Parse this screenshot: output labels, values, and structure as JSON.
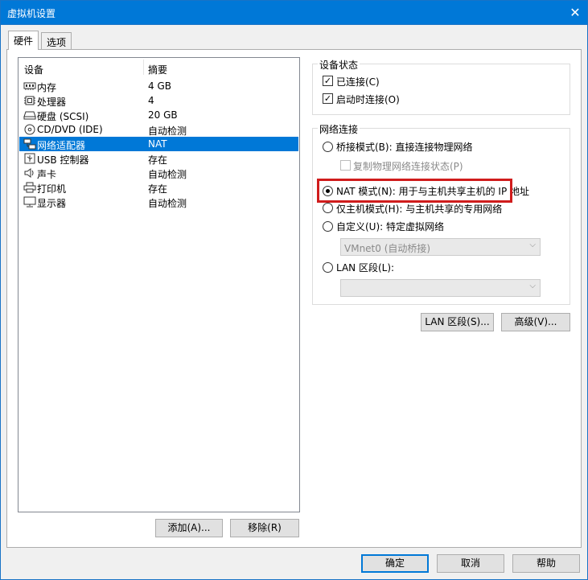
{
  "window": {
    "title": "虚拟机设置",
    "close": "✕"
  },
  "tabs": [
    {
      "label": "硬件"
    },
    {
      "label": "选项"
    }
  ],
  "device_list": {
    "headers": {
      "device": "设备",
      "summary": "摘要"
    },
    "rows": [
      {
        "name": "内存",
        "summary": "4 GB",
        "icon": "memory-icon"
      },
      {
        "name": "处理器",
        "summary": "4",
        "icon": "processor-icon"
      },
      {
        "name": "硬盘 (SCSI)",
        "summary": "20 GB",
        "icon": "hard-disk-icon"
      },
      {
        "name": "CD/DVD (IDE)",
        "summary": "自动检测",
        "icon": "cd-dvd-icon"
      },
      {
        "name": "网络适配器",
        "summary": "NAT",
        "icon": "network-adapter-icon",
        "selected": true
      },
      {
        "name": "USB 控制器",
        "summary": "存在",
        "icon": "usb-icon"
      },
      {
        "name": "声卡",
        "summary": "自动检测",
        "icon": "sound-icon"
      },
      {
        "name": "打印机",
        "summary": "存在",
        "icon": "printer-icon"
      },
      {
        "name": "显示器",
        "summary": "自动检测",
        "icon": "display-icon"
      }
    ]
  },
  "list_buttons": {
    "add": "添加(A)...",
    "remove": "移除(R)"
  },
  "device_status": {
    "title": "设备状态",
    "connected": {
      "label": "已连接(C)",
      "checked": true
    },
    "connect_at_power_on": {
      "label": "启动时连接(O)",
      "checked": true
    }
  },
  "network_connection": {
    "title": "网络连接",
    "bridged": {
      "label": "桥接模式(B): 直接连接物理网络",
      "selected": false
    },
    "replicate": {
      "label": "复制物理网络连接状态(P)",
      "checked": false
    },
    "nat": {
      "label": "NAT 模式(N): 用于与主机共享主机的 IP 地址",
      "selected": true
    },
    "host_only": {
      "label": "仅主机模式(H): 与主机共享的专用网络",
      "selected": false
    },
    "custom": {
      "label": "自定义(U): 特定虚拟网络",
      "selected": false,
      "combo_value": "VMnet0 (自动桥接)"
    },
    "lan_segment": {
      "label": "LAN 区段(L):",
      "selected": false,
      "combo_value": ""
    }
  },
  "right_buttons": {
    "lan_segments": "LAN 区段(S)...",
    "advanced": "高级(V)..."
  },
  "footer_buttons": {
    "ok": "确定",
    "cancel": "取消",
    "help": "帮助"
  },
  "colors": {
    "title_bar": "#0078d7",
    "selection": "#0078d7",
    "highlight_box": "#d01c1c"
  }
}
